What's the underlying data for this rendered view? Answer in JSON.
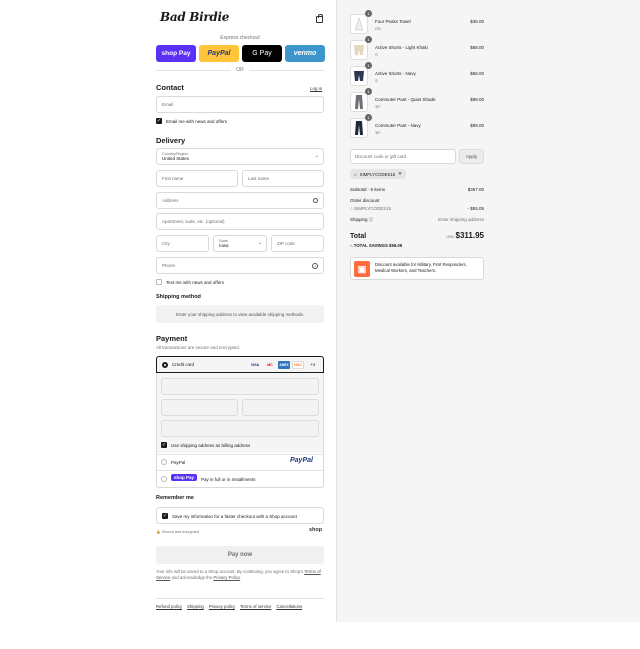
{
  "brand": {
    "logo": "Bad Birdie"
  },
  "express": {
    "label": "Express checkout",
    "buttons": [
      {
        "label": "shop Pay",
        "color": "#5a31f4"
      },
      {
        "label": "PayPal",
        "color": "#ffc439"
      },
      {
        "label": "G Pay",
        "color": "#000000"
      },
      {
        "label": "venmo",
        "color": "#3d95ce"
      }
    ],
    "or": "OR"
  },
  "contact": {
    "title": "Contact",
    "login": "Log in",
    "email_placeholder": "Email",
    "news_label": "Email me with news and offers"
  },
  "delivery": {
    "title": "Delivery",
    "country_label": "Country/Region",
    "country_value": "United States",
    "first_name": "First name",
    "last_name": "Last name",
    "address": "Address",
    "apartment": "Apartment, suite, etc. (optional)",
    "city": "City",
    "state_label": "State",
    "state_value": "Iowa",
    "zip": "ZIP code",
    "phone": "Phone",
    "text_label": "Text me with news and offers"
  },
  "shipping": {
    "title": "Shipping method",
    "message": "Enter your shipping address to view available shipping methods."
  },
  "payment": {
    "title": "Payment",
    "subtitle": "All transactions are secure and encrypted.",
    "credit_card": "Credit card",
    "card_brands": [
      "VISA",
      "MC",
      "AMEX",
      "DISC"
    ],
    "more": "+4",
    "billing_label": "Use shipping address as billing address",
    "paypal": "PayPal",
    "paypal_logo": "PayPal",
    "shoppay": "shop Pay",
    "shoppay_label": "Pay in full or in installments"
  },
  "remember": {
    "title": "Remember me",
    "save_label": "Save my information for a faster checkout with a Shop account",
    "secure": "Secure and encrypted",
    "shop": "shop"
  },
  "pay_now": "Pay now",
  "fine_print": {
    "prefix": "Your info will be saved to a Shop account. By continuing, you agree to Shop's",
    "terms": "Terms of Service",
    "mid": "and acknowledge the",
    "privacy": "Privacy Policy",
    "end": "."
  },
  "footer": [
    "Refund policy",
    "Shipping",
    "Privacy policy",
    "Terms of service",
    "Cancellations"
  ],
  "cart": {
    "items": [
      {
        "qty": "1",
        "name": "Four Peaks Towel",
        "variant": "OS",
        "price": "$35.00"
      },
      {
        "qty": "1",
        "name": "Active Shorts - Light Khaki",
        "variant": "S",
        "price": "$68.00"
      },
      {
        "qty": "1",
        "name": "Active Shorts - Navy",
        "variant": "S",
        "price": "$68.00"
      },
      {
        "qty": "1",
        "name": "Commuter Pant - Quiet Shade",
        "variant": "30\"",
        "price": "$98.00"
      },
      {
        "qty": "1",
        "name": "Commuter Pant - Navy",
        "variant": "30\"",
        "price": "$98.00"
      }
    ]
  },
  "discount": {
    "placeholder": "Discount code or gift card",
    "apply": "Apply",
    "code": "SIMPLYCODES15"
  },
  "summary": {
    "subtotal_label": "Subtotal · 5 items",
    "subtotal": "$367.00",
    "order_discount": "Order discount",
    "code": "SIMPLYCODES15",
    "code_amount": "- $55.05",
    "shipping_label": "Shipping",
    "shipping_value": "Enter shipping address",
    "total_label": "Total",
    "currency": "USD",
    "total": "$311.95",
    "savings": "TOTAL SAVINGS $55.05"
  },
  "promo": {
    "text": "Discount available for Military, First Responders, Medical Workers, and Teachers."
  }
}
